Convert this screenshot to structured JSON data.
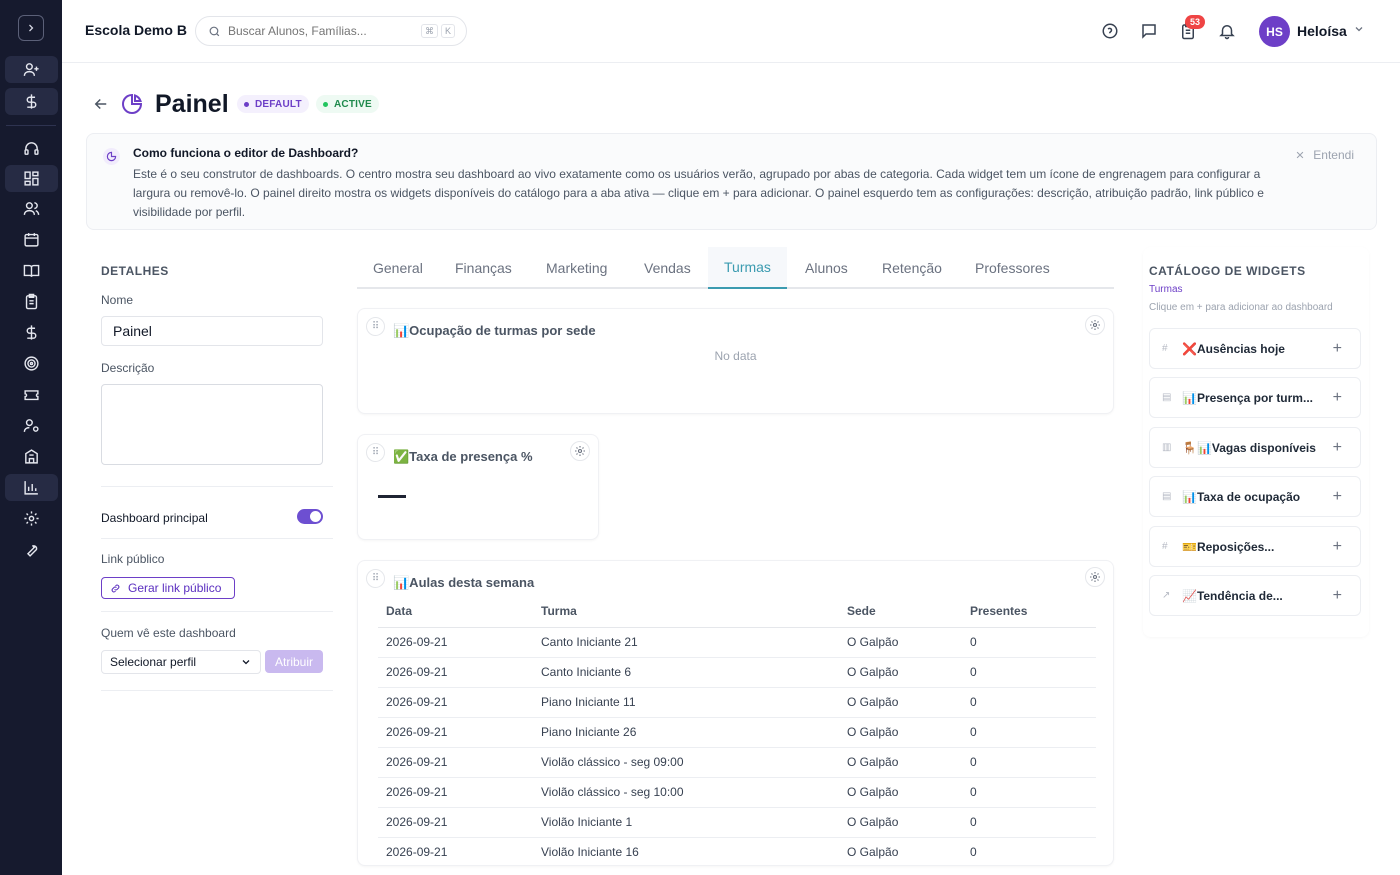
{
  "header": {
    "school_name": "Escola Demo B",
    "search_placeholder": "Buscar Alunos, Famílias...",
    "kbd_1": "⌘",
    "kbd_2": "K",
    "notification_count": "53",
    "user_initials": "HS",
    "user_name": "Heloísa"
  },
  "page": {
    "title": "Painel",
    "badge_default": "DEFAULT",
    "badge_active": "ACTIVE"
  },
  "info": {
    "title": "Como funciona o editor de Dashboard?",
    "text": "Este é o seu construtor de dashboards. O centro mostra seu dashboard ao vivo exatamente como os usuários verão, agrupado por abas de categoria. Cada widget tem um ícone de engrenagem para configurar a largura ou removê-lo. O painel direito mostra os widgets disponíveis do catálogo para a aba ativa — clique em + para adicionar. O painel esquerdo tem as configurações: descrição, atribuição padrão, link público e visibilidade por perfil.",
    "dismiss": "Entendi"
  },
  "details": {
    "section_title": "DETALHES",
    "name_label": "Nome",
    "name_value": "Painel",
    "description_label": "Descrição",
    "description_value": "",
    "main_dashboard_label": "Dashboard principal",
    "main_dashboard_on": true,
    "public_link_label": "Link público",
    "public_link_button": "Gerar link público",
    "visibility_label": "Quem vê este dashboard",
    "profile_select": "Selecionar perfil",
    "assign_button": "Atribuir"
  },
  "tabs": [
    "General",
    "Finanças",
    "Marketing",
    "Vendas",
    "Turmas",
    "Alunos",
    "Retenção",
    "Professores"
  ],
  "active_tab": "Turmas",
  "widgets": {
    "occupancy": {
      "title": "📊Ocupação de turmas por sede",
      "empty": "No data"
    },
    "attendance": {
      "title": "✅Taxa de presença %"
    },
    "classes": {
      "title": "📊Aulas desta semana",
      "columns": [
        "Data",
        "Turma",
        "Sede",
        "Presentes"
      ],
      "rows": [
        [
          "2026-09-21",
          "Canto Iniciante 21",
          "O Galpão",
          "0"
        ],
        [
          "2026-09-21",
          "Canto Iniciante 6",
          "O Galpão",
          "0"
        ],
        [
          "2026-09-21",
          "Piano Iniciante 11",
          "O Galpão",
          "0"
        ],
        [
          "2026-09-21",
          "Piano Iniciante 26",
          "O Galpão",
          "0"
        ],
        [
          "2026-09-21",
          "Violão clássico - seg 09:00",
          "O Galpão",
          "0"
        ],
        [
          "2026-09-21",
          "Violão clássico - seg 10:00",
          "O Galpão",
          "0"
        ],
        [
          "2026-09-21",
          "Violão Iniciante 1",
          "O Galpão",
          "0"
        ],
        [
          "2026-09-21",
          "Violão Iniciante 16",
          "O Galpão",
          "0"
        ]
      ]
    }
  },
  "catalog": {
    "title": "CATÁLOGO DE WIDGETS",
    "category": "Turmas",
    "hint": "Clique em + para adicionar ao dashboard",
    "items": [
      {
        "icon": "#",
        "label": "❌Ausências hoje"
      },
      {
        "icon": "▤",
        "label": "📊Presença por turm..."
      },
      {
        "icon": "▥",
        "label": "🪑📊Vagas disponíveis"
      },
      {
        "icon": "▤",
        "label": "📊Taxa de ocupação"
      },
      {
        "icon": "#",
        "label": "🎫Reposições..."
      },
      {
        "icon": "↗",
        "label": "📈Tendência de..."
      }
    ]
  },
  "colors": {
    "sidebar_bg": "#161a2e",
    "accent": "#6d3fc7",
    "active_tab": "#3b9bb0",
    "notification_badge": "#ef4444"
  }
}
